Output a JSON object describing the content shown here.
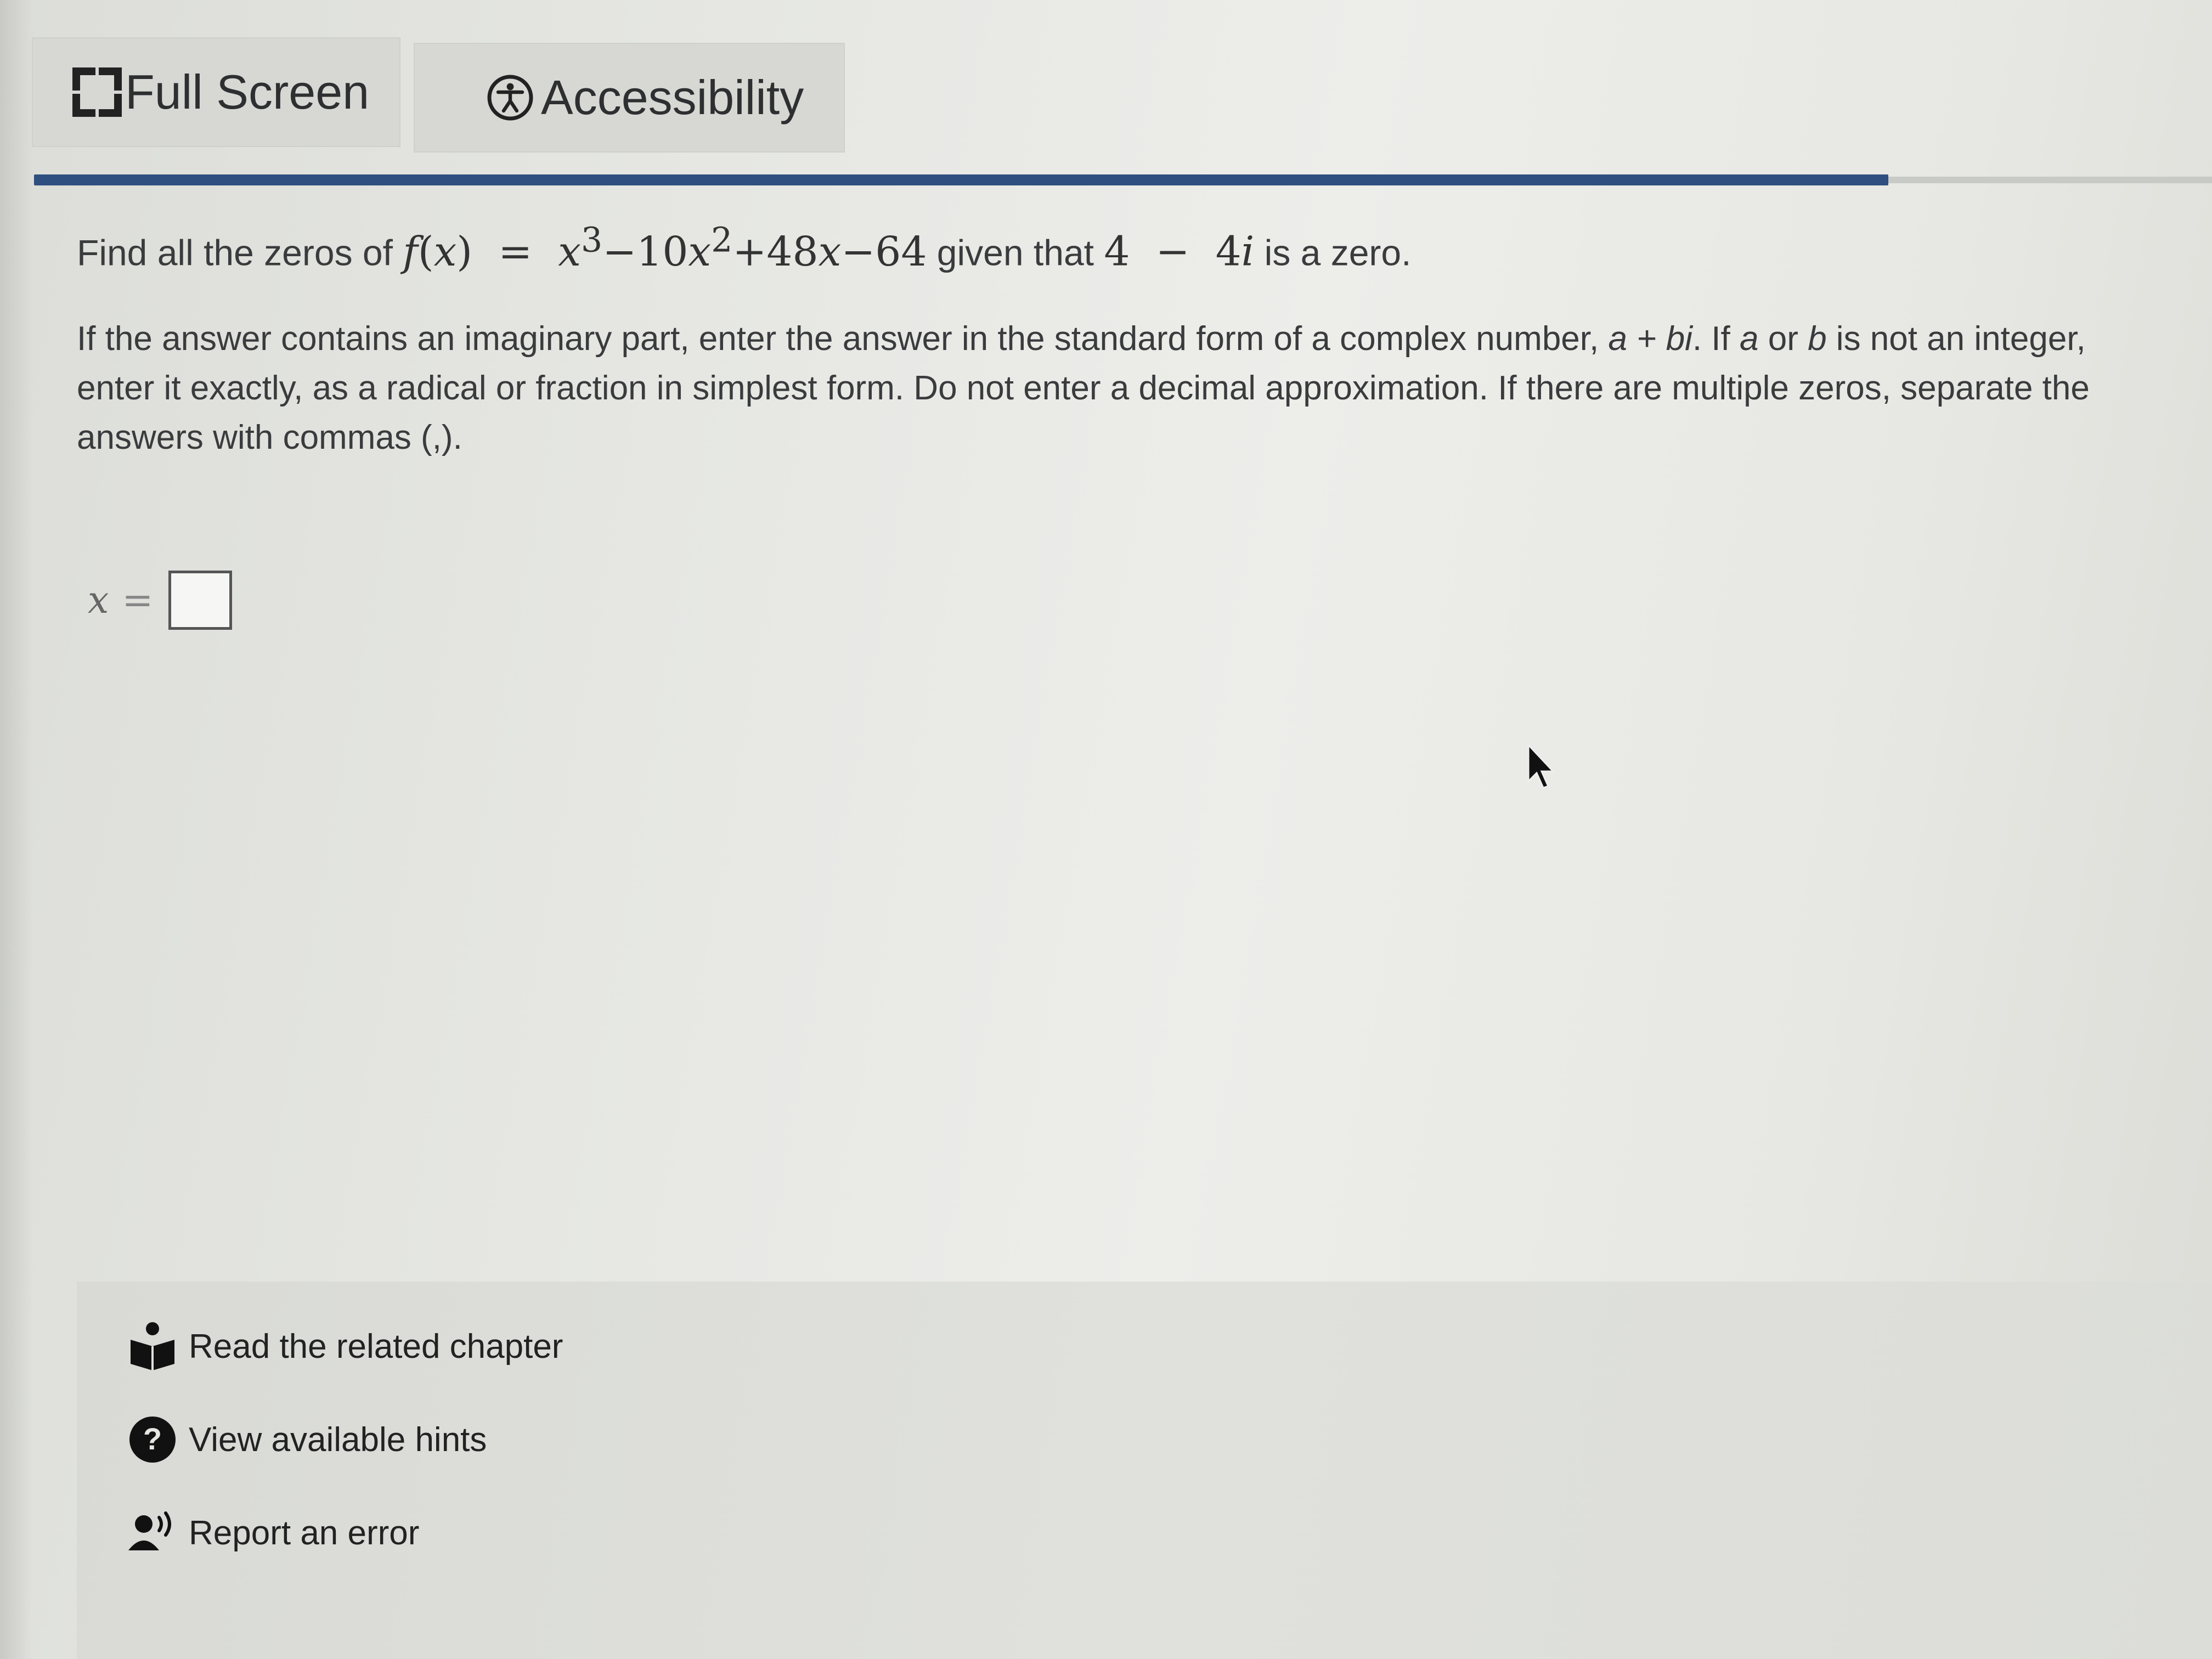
{
  "toolbar": {
    "fullscreen_label": "Full Screen",
    "accessibility_label": "Accessibility"
  },
  "question": {
    "prefix": "Find all the zeros of ",
    "function_name": "f",
    "variable": "x",
    "equals": "=",
    "polynomial_terms": {
      "t1_base": "x",
      "t1_exp": "3",
      "t2": "−10",
      "t2_var": "x",
      "t2_exp": "2",
      "t3": "+48",
      "t3_var": "x",
      "t4": "−64"
    },
    "given_text": " given that ",
    "given_zero_real": "4",
    "given_zero_minus": "−",
    "given_zero_imag": "4",
    "given_zero_i": "i",
    "suffix": " is a zero."
  },
  "instructions": {
    "part1": "If the answer contains an imaginary part, enter the answer in the standard form of a complex number, ",
    "form": "a + bi",
    "part2": ". If ",
    "a": "a",
    "or": " or ",
    "b": "b",
    "part3": " is not an integer, enter it exactly, as a radical or fraction in simplest form. Do not enter a decimal approximation. If there are multiple zeros, separate the answers with commas (,)."
  },
  "answer": {
    "variable": "x",
    "equals": "=",
    "value": ""
  },
  "helpers": {
    "chapter": "Read the related chapter",
    "hints": "View available hints",
    "report": "Report an error"
  },
  "colors": {
    "accent_bar": "#2e4f80",
    "text": "#3a3b3d"
  },
  "icons": [
    "fullscreen-icon",
    "accessibility-icon",
    "book-reader-icon",
    "question-circle-icon",
    "report-speaker-icon",
    "mouse-cursor-icon"
  ]
}
